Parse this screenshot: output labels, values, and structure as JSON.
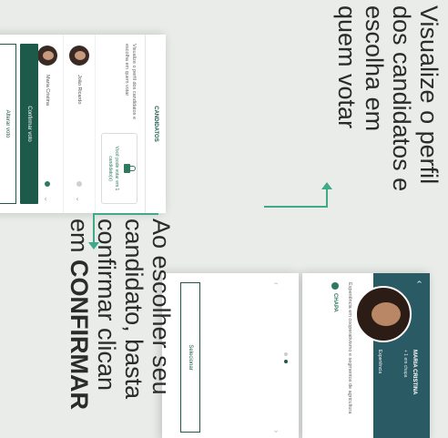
{
  "caption_top": {
    "lines": [
      "Visualize o perfil",
      "dos candidatos e",
      "escolha em",
      "quem votar"
    ]
  },
  "caption_bottom": {
    "lines": [
      "Ao escolher seu",
      "candidato, basta",
      "confirmar clican"
    ],
    "last_prefix": "em ",
    "last_bold": "CONFIRMAR"
  },
  "candidates_screen": {
    "title": "CANDIDATOS",
    "intro": "Visualize o perfil dos candidatos e escolha em quem votar",
    "vote_card_label": "Você pode votar em 1 candidato(s)",
    "candidates": [
      {
        "name": "João Ricardo",
        "selected": false
      },
      {
        "name": "Maria Cristina",
        "selected": true
      }
    ],
    "confirm_label": "Confirmar voto",
    "change_label": "Alterar voto"
  },
  "profile_screen": {
    "name": "MARIA CRISTINA",
    "subtitle": "+ 1 em chapa",
    "tab_label": "Experiência",
    "body": "Experiência em cooperativismo e segmentos de agricultura",
    "chapa_label": "CHAPA",
    "select_label": "Selecionar",
    "pager_dots": 2,
    "pager_active": 1
  },
  "colors": {
    "accent": "#1e5a4a",
    "connector": "#3fa98a",
    "profile_cover": "#2a5a63",
    "background": "#e9ece9"
  },
  "icons": [
    "lock-icon",
    "chevron-down-icon",
    "back-arrow-icon",
    "chapa-icon"
  ]
}
